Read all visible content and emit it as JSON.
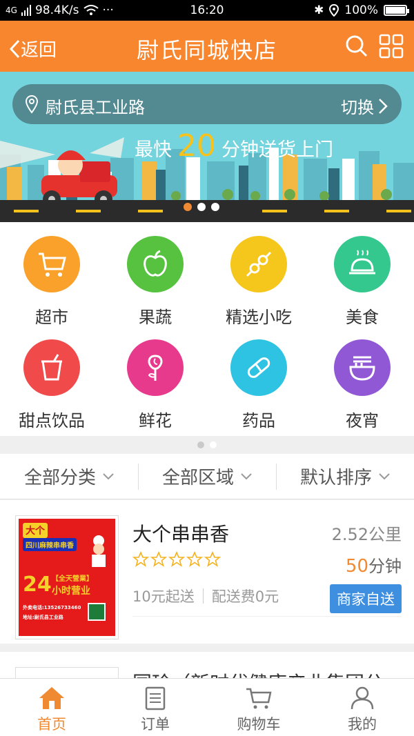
{
  "status_bar": {
    "signal": "4G",
    "speed": "98.4K/s",
    "more": "···",
    "time": "16:20",
    "battery": "100%"
  },
  "header": {
    "back_label": "返回",
    "title": "尉氏同城快店"
  },
  "banner": {
    "address": "尉氏县工业路",
    "switch_label": "切换",
    "slogan_pre": "最快",
    "slogan_num": "20",
    "slogan_post": "分钟送货上门",
    "active_slide": 1,
    "slide_count": 3
  },
  "categories": [
    {
      "label": "超市",
      "icon": "cart-icon",
      "color": "#f9a12a"
    },
    {
      "label": "果蔬",
      "icon": "apple-icon",
      "color": "#56c240"
    },
    {
      "label": "精选小吃",
      "icon": "skewer-icon",
      "color": "#f5c61b"
    },
    {
      "label": "美食",
      "icon": "dish-icon",
      "color": "#34c88e"
    },
    {
      "label": "甜点饮品",
      "icon": "drink-icon",
      "color": "#f04a4a"
    },
    {
      "label": "鲜花",
      "icon": "rose-icon",
      "color": "#e83a8c"
    },
    {
      "label": "药品",
      "icon": "pill-icon",
      "color": "#2ec3e2"
    },
    {
      "label": "夜宵",
      "icon": "noodle-icon",
      "color": "#9158d6"
    }
  ],
  "filters": {
    "category": "全部分类",
    "area": "全部区域",
    "sort": "默认排序"
  },
  "shop": {
    "name": "大个串串香",
    "distance": "2.52公里",
    "rating": 0,
    "rating_max": 5,
    "time_num": "50",
    "time_unit": "分钟",
    "min_order": "10元起送",
    "delivery_fee": "配送费0元",
    "delivery_badge": "商家自送",
    "poster": {
      "top": "大个",
      "line1": "四川麻辣串串香",
      "hours_num": "24",
      "hours_tag": "【全天營業】",
      "hours_text": "小时营业",
      "phone": "外卖电话:13526733460",
      "addr": "地址:尉氏县工业路"
    }
  },
  "shop2": {
    "name": "国珍（新时代健康产业集团公"
  },
  "tabbar": [
    {
      "label": "首页",
      "icon": "home-icon",
      "active": true
    },
    {
      "label": "订单",
      "icon": "order-icon",
      "active": false
    },
    {
      "label": "购物车",
      "icon": "cart-icon",
      "active": false
    },
    {
      "label": "我的",
      "icon": "user-icon",
      "active": false
    }
  ],
  "colors": {
    "brand": "#f8862f",
    "accent": "#f08a32",
    "badge": "#3f8fe0"
  }
}
